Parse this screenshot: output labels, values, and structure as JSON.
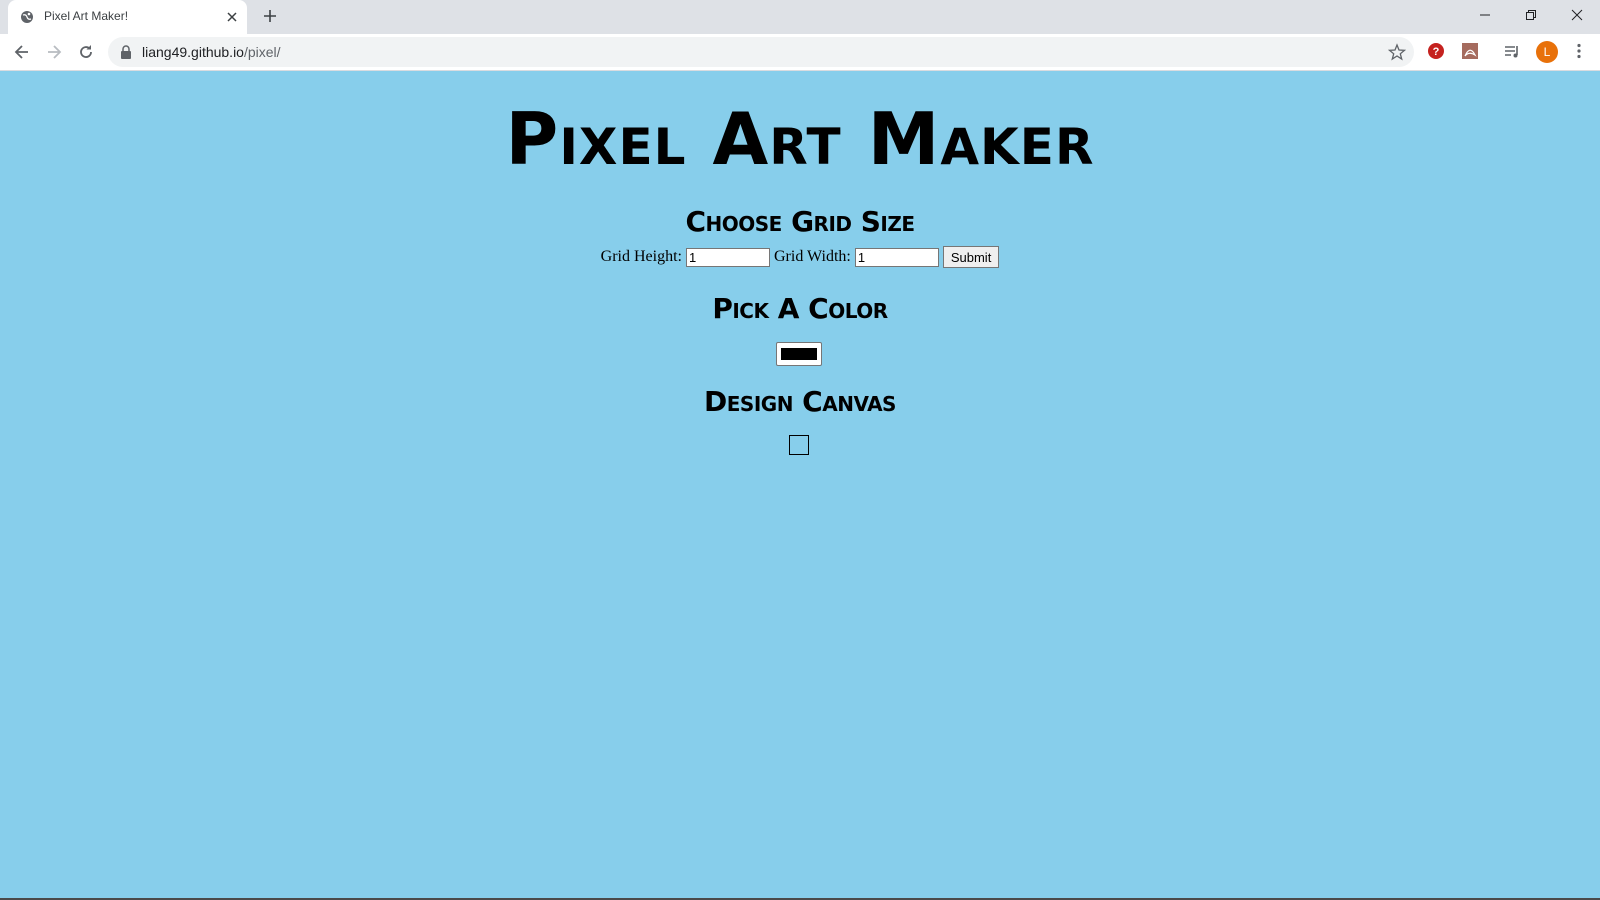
{
  "browser": {
    "tab_title": "Pixel Art Maker!",
    "url_host": "liang49.github.io",
    "url_path": "/pixel/",
    "avatar_letter": "L"
  },
  "page": {
    "title": "Pixel Art Maker",
    "grid_section_title": "Choose Grid Size",
    "grid_height_label": "Grid Height:",
    "grid_height_value": "1",
    "grid_width_label": "Grid Width:",
    "grid_width_value": "1",
    "submit_label": "Submit",
    "color_section_title": "Pick A Color",
    "selected_color": "#000000",
    "canvas_section_title": "Design Canvas"
  },
  "colors": {
    "page_background": "#87ceeb",
    "avatar": "#e8710a"
  }
}
